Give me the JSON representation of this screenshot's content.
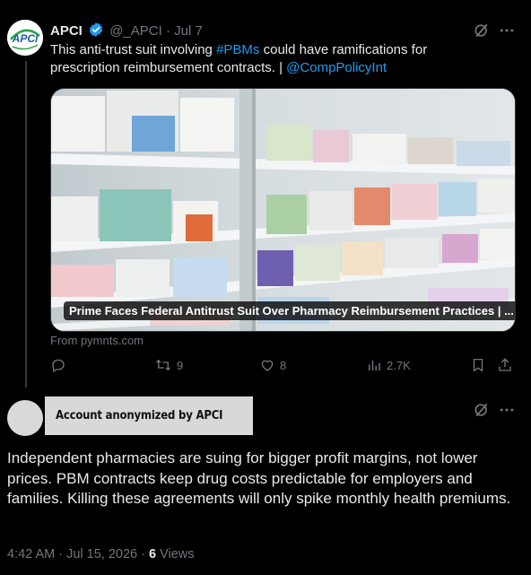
{
  "tweet": {
    "author_name": "APCI",
    "author_handle": "@_APCI",
    "date": "Jul 7",
    "text_plain_1": "This anti-trust suit involving ",
    "hashtag": "#PBMs",
    "text_plain_2": " could have ramifications for prescription reimbursement contracts. | ",
    "mention": "@CompPolicyInt",
    "avatar_logo_text": "APCI",
    "card": {
      "title": "Prime Faces Federal Antitrust Suit Over Pharmacy Reimbursement Practices | ...",
      "source": "From pymnts.com"
    },
    "stats": {
      "retweets": "9",
      "likes": "8",
      "views": "2.7K"
    },
    "icons": [
      "grok-icon",
      "more-icon",
      "reply-icon",
      "retweet-icon",
      "like-icon",
      "views-icon",
      "bookmark-icon",
      "share-icon"
    ]
  },
  "reply": {
    "author_label": "Account anonymized by APCI",
    "text": "Independent pharmacies are suing for bigger profit margins, not lower prices. PBM contracts keep drug costs predictable for employers and families. Killing these agreements will only spike monthly health premiums.",
    "time": "4:42 AM · Jul 15, 2026 · ",
    "views_count": "6",
    "views_label": " Views"
  },
  "colors": {
    "background": "#000000",
    "text": "#e7e9ea",
    "muted": "#71767b",
    "link": "#1d9bf0",
    "verified": "#1d9bf0"
  }
}
